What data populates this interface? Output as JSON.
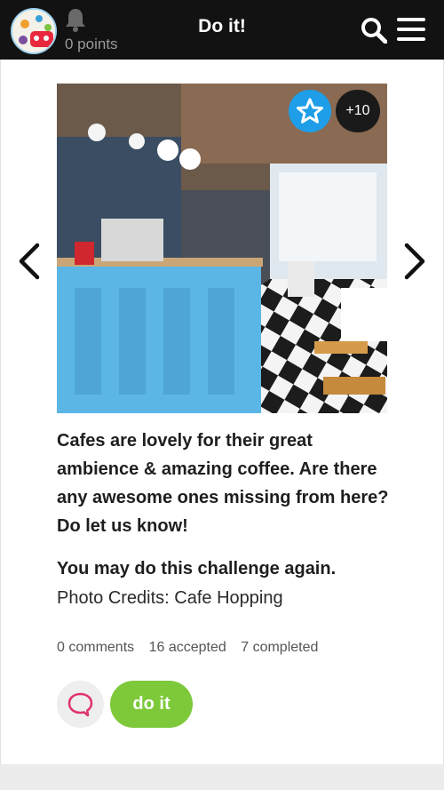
{
  "header": {
    "title": "Do it!",
    "points": "0 points"
  },
  "challenge": {
    "badge_points": "+10",
    "description": "Cafes are lovely for their great ambience & amazing coffee. Are there any awesome ones missing from here? Do let us know!",
    "repeat_note": "You may do this challenge again.",
    "credits": "Photo Credits: Cafe Hopping",
    "stats": {
      "comments": "0 comments",
      "accepted": "16 accepted",
      "completed": "7 completed"
    },
    "do_it_label": "do it"
  },
  "colors": {
    "topbar": "#121212",
    "star_badge": "#1e9ee8",
    "do_it": "#7dc93a",
    "comment_icon": "#e0336a"
  },
  "icons": {
    "bell": "bell-icon",
    "search": "search-icon",
    "menu": "menu-icon",
    "star": "star-icon",
    "prev": "chevron-left-icon",
    "next": "chevron-right-icon",
    "comment": "comment-icon"
  }
}
